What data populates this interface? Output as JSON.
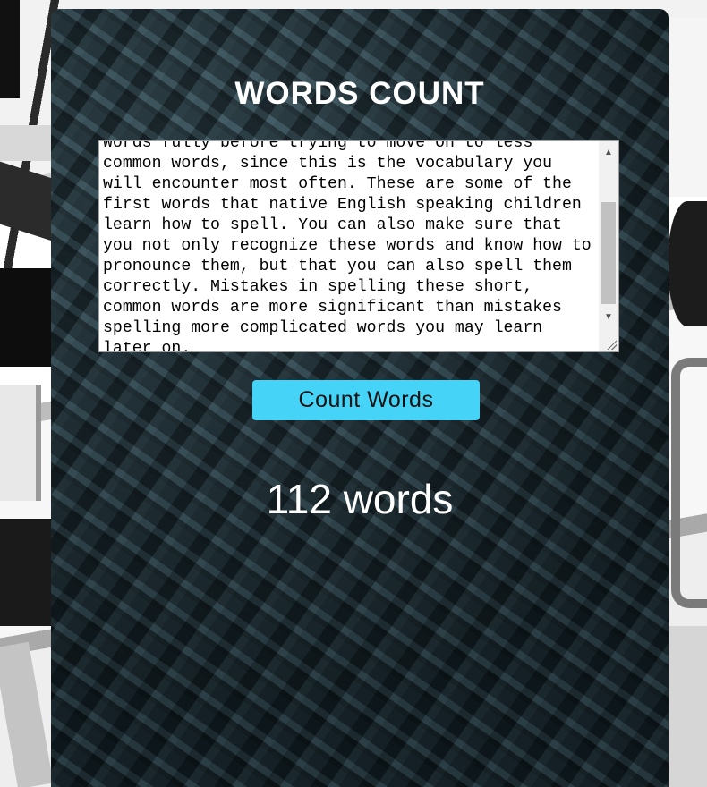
{
  "app": {
    "title": "WORDS COUNT"
  },
  "input": {
    "visible_text": "Words fully before trying to move on to less\ncommon words, since this is the vocabulary you\nwill encounter most often. These are some of the\nfirst words that native English speaking children\nlearn how to spell. You can also make sure that\nyou not only recognize these words and know how to\npronounce them, but that you can also spell them\ncorrectly. Mistakes in spelling these short,\ncommon words are more significant than mistakes\nspelling more complicated words you may learn\nlater on."
  },
  "actions": {
    "count_label": "Count Words"
  },
  "result": {
    "text": "112 words"
  },
  "colors": {
    "button": "#45d3f7",
    "title": "#ffffff"
  },
  "icons": {
    "scroll_up": "scroll-up-arrow-icon",
    "scroll_down": "scroll-down-arrow-icon",
    "resize": "resize-grip-icon"
  }
}
